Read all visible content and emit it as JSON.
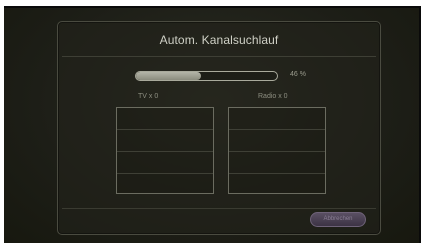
{
  "dialog": {
    "title": "Autom. Kanalsuchlauf",
    "progress": {
      "percent": 46,
      "label": "46 %"
    },
    "tv": {
      "label": "TV x 0"
    },
    "radio": {
      "label": "Radio x 0"
    },
    "cancel_label": "Abbrechen"
  },
  "colors": {
    "background": "#1d1e17",
    "progress_fill": "#a3a496",
    "button": "#4b4154"
  }
}
